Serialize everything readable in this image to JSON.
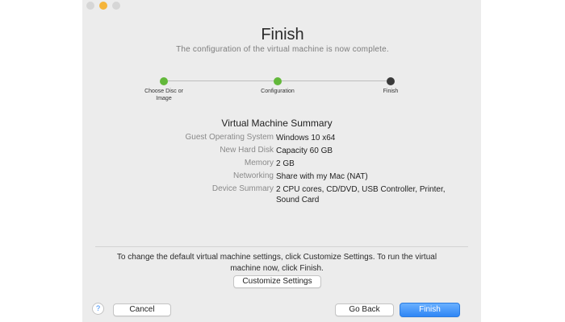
{
  "window": {
    "title": "Finish",
    "subtitle": "The configuration of the virtual machine is now complete."
  },
  "steps": [
    {
      "label": "Choose Disc or Image",
      "state": "done"
    },
    {
      "label": "Configuration",
      "state": "done"
    },
    {
      "label": "Finish",
      "state": "current"
    }
  ],
  "summary": {
    "title": "Virtual Machine Summary",
    "rows": [
      {
        "label": "Guest Operating System",
        "value": "Windows 10 x64"
      },
      {
        "label": "New Hard Disk",
        "value": "Capacity 60 GB"
      },
      {
        "label": "Memory",
        "value": "2 GB"
      },
      {
        "label": "Networking",
        "value": "Share with my Mac (NAT)"
      },
      {
        "label": "Device Summary",
        "value": "2 CPU cores, CD/DVD, USB Controller, Printer,",
        "value2": "Sound Card"
      }
    ]
  },
  "hint": "To change the default virtual machine settings, click Customize Settings. To run the virtual machine now, click Finish.",
  "buttons": {
    "customize": "Customize Settings",
    "cancel": "Cancel",
    "back": "Go Back",
    "finish": "Finish",
    "help": "?"
  },
  "colors": {
    "step_done": "#62b83a",
    "step_current": "#3a3a3a",
    "primary": "#2f86f5"
  }
}
